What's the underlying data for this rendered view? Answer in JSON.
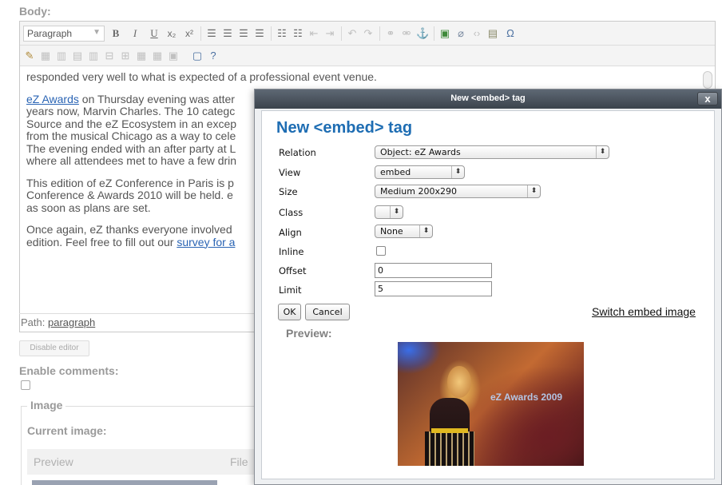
{
  "page": {
    "body_label": "Body:",
    "format_select": "Paragraph",
    "toolbar_text": {
      "bold": "B",
      "italic": "I",
      "underline": "U",
      "subscript": "x₂",
      "superscript": "x²",
      "special_char": "Ω"
    },
    "paragraphs": [
      {
        "parts": [
          {
            "text": "responded very well to what is expected of a ",
            "link": false
          },
          {
            "text": "professional event venue.",
            "link": false
          }
        ]
      },
      {
        "parts": [
          {
            "text": "eZ Awards",
            "link": true
          },
          {
            "text": " on Thursday evening was atter",
            "link": false
          }
        ]
      },
      {
        "parts": [
          {
            "text": "years now, Marvin Charles. The 10 categc",
            "link": false
          }
        ]
      },
      {
        "parts": [
          {
            "text": "Source and the eZ Ecosystem in an excep",
            "link": false
          }
        ]
      },
      {
        "parts": [
          {
            "text": "from the musical Chicago as a way to cele",
            "link": false
          }
        ]
      },
      {
        "parts": [
          {
            "text": "The evening ended with an after party at L",
            "link": false
          }
        ]
      },
      {
        "parts": [
          {
            "text": "where all attendees met to have a few drin",
            "link": false
          }
        ]
      },
      {
        "parts": [
          {
            "text": "This edition of eZ Conference in Paris is p",
            "link": false
          }
        ]
      },
      {
        "parts": [
          {
            "text": "Conference & Awards 2010 will be held. e",
            "link": false
          }
        ]
      },
      {
        "parts": [
          {
            "text": "as soon as plans are set.",
            "link": false
          }
        ]
      },
      {
        "parts": [
          {
            "text": "Once again, eZ thanks everyone involved",
            "link": false
          }
        ]
      },
      {
        "parts": [
          {
            "text": "edition. Feel free to fill out our ",
            "link": false
          },
          {
            "text": "survey for a",
            "link": true
          }
        ]
      }
    ],
    "path_label": "Path:",
    "path_value": "paragraph",
    "disable_editor": "Disable editor",
    "enable_comments": "Enable comments:",
    "image_legend": "Image",
    "current_image": "Current image:",
    "table_headers": [
      "Preview",
      "File"
    ]
  },
  "dialog": {
    "titlebar": "New <embed> tag",
    "close_label": "x",
    "heading": "New <embed> tag",
    "fields": {
      "relation": {
        "label": "Relation",
        "value": "Object: eZ Awards"
      },
      "view": {
        "label": "View",
        "value": "embed"
      },
      "size": {
        "label": "Size",
        "value": "Medium 200x290"
      },
      "class": {
        "label": "Class",
        "value": ""
      },
      "align": {
        "label": "Align",
        "value": "None"
      },
      "inline": {
        "label": "Inline",
        "checked": false
      },
      "offset": {
        "label": "Offset",
        "value": "0"
      },
      "limit": {
        "label": "Limit",
        "value": "5"
      }
    },
    "ok_label": "OK",
    "cancel_label": "Cancel",
    "switch_link": "Switch embed image",
    "preview_label": "Preview:",
    "preview_watermark": "eZ Awards 2009"
  },
  "colors": {
    "heading_blue": "#1e6db3",
    "link_blue": "#2a64b4",
    "titlebar_dark": "#3b434c"
  }
}
